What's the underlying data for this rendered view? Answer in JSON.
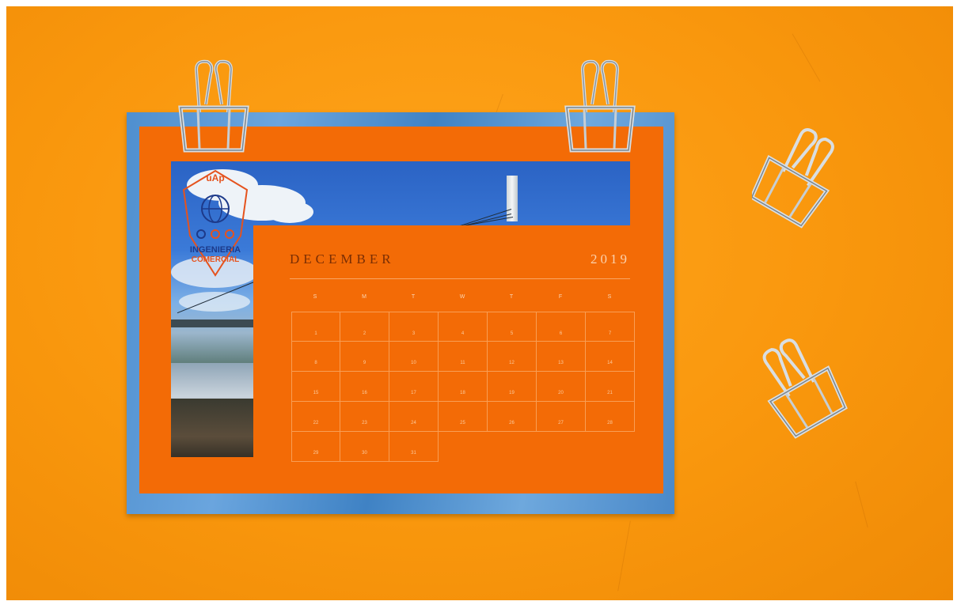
{
  "calendar": {
    "month": "DECEMBER",
    "year": "2019",
    "weekdays": [
      "S",
      "M",
      "T",
      "W",
      "T",
      "F",
      "S"
    ],
    "weeks": [
      [
        "1",
        "2",
        "3",
        "4",
        "5",
        "6",
        "7"
      ],
      [
        "8",
        "9",
        "10",
        "11",
        "12",
        "13",
        "14"
      ],
      [
        "15",
        "16",
        "17",
        "18",
        "19",
        "20",
        "21"
      ],
      [
        "22",
        "23",
        "24",
        "25",
        "26",
        "27",
        "28"
      ],
      [
        "29",
        "30",
        "31"
      ]
    ]
  },
  "logo": {
    "top_text": "uAp",
    "line1": "INGENIERIA",
    "line2": "COMERCIAL"
  },
  "colors": {
    "background": "#f9970d",
    "sheet": "#f36b06",
    "board": "#4f8fcf"
  },
  "icons": [
    "binder-clip",
    "binder-clip",
    "binder-clip",
    "binder-clip"
  ]
}
